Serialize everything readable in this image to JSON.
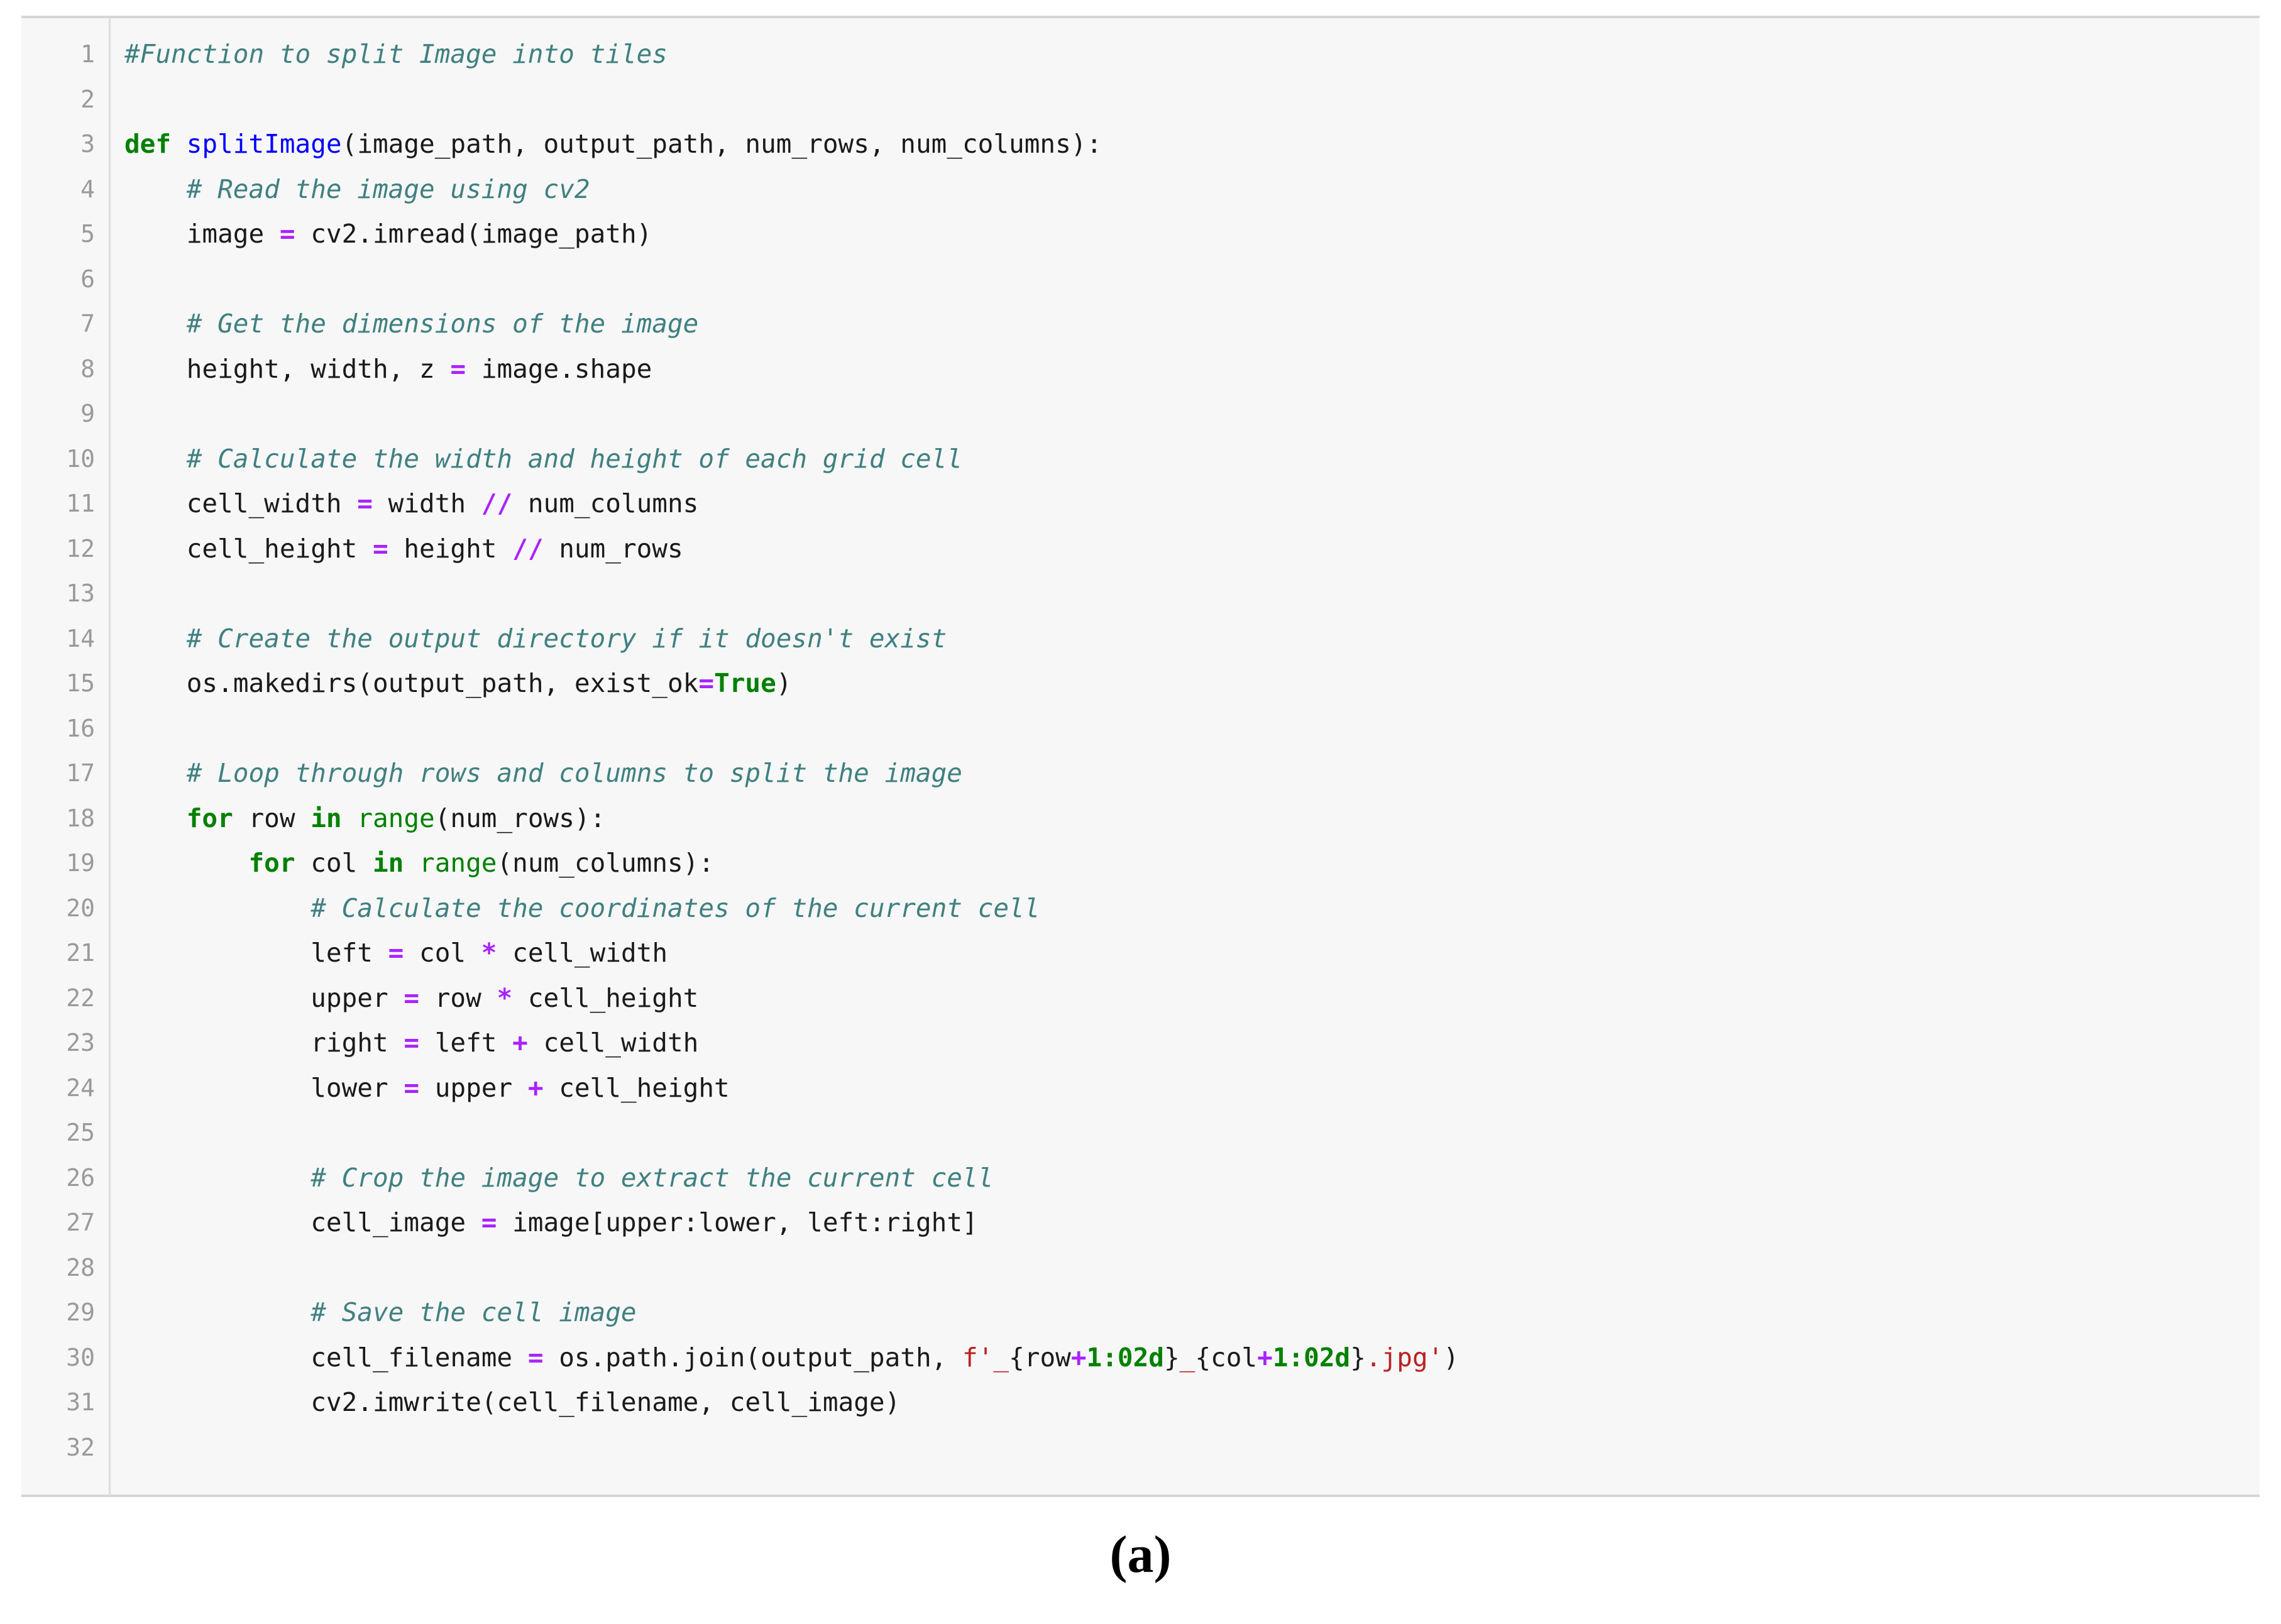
{
  "code_block": {
    "language": "python",
    "line_numbers": [
      1,
      2,
      3,
      4,
      5,
      6,
      7,
      8,
      9,
      10,
      11,
      12,
      13,
      14,
      15,
      16,
      17,
      18,
      19,
      20,
      21,
      22,
      23,
      24,
      25,
      26,
      27,
      28,
      29,
      30,
      31,
      32
    ],
    "lines": [
      "#Function to split Image into tiles",
      "",
      "def splitImage(image_path, output_path, num_rows, num_columns):",
      "    # Read the image using cv2",
      "    image = cv2.imread(image_path)",
      "",
      "    # Get the dimensions of the image",
      "    height, width, z = image.shape",
      "",
      "    # Calculate the width and height of each grid cell",
      "    cell_width = width // num_columns",
      "    cell_height = height // num_rows",
      "",
      "    # Create the output directory if it doesn't exist",
      "    os.makedirs(output_path, exist_ok=True)",
      "",
      "    # Loop through rows and columns to split the image",
      "    for row in range(num_rows):",
      "        for col in range(num_columns):",
      "            # Calculate the coordinates of the current cell",
      "            left = col * cell_width",
      "            upper = row * cell_height",
      "            right = left + cell_width",
      "            lower = upper + cell_height",
      "",
      "            # Crop the image to extract the current cell",
      "            cell_image = image[upper:lower, left:right]",
      "",
      "            # Save the cell image",
      "            cell_filename = os.path.join(output_path, f'_{row+1:02d}_{col+1:02d}.jpg')",
      "            cv2.imwrite(cell_filename, cell_image)",
      ""
    ],
    "colors": {
      "background": "#f7f7f7",
      "border": "#d6d6d6",
      "gutter_text": "#9a9a9a",
      "gutter_divider": "#dcdcdc",
      "comment": "#408080",
      "keyword": "#008000",
      "builtin": "#008000",
      "function_name": "#0000ff",
      "operator": "#aa22ff",
      "string": "#ba2121",
      "number": "#008000",
      "plain": "#1a1a1a"
    }
  },
  "caption": {
    "label": "(a)"
  }
}
